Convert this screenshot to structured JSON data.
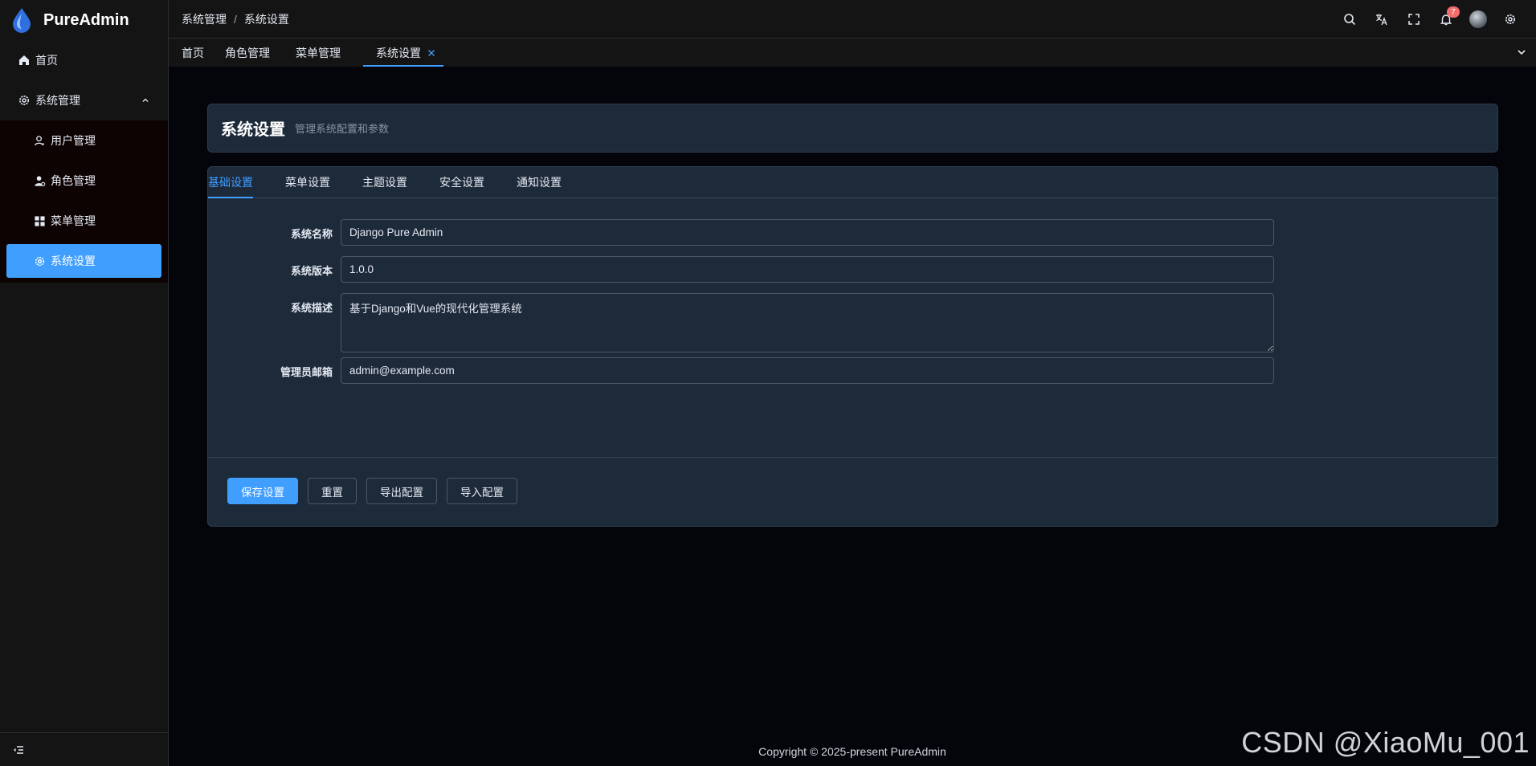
{
  "app": {
    "name": "PureAdmin"
  },
  "sidebar": {
    "home": "首页",
    "group": "系统管理",
    "items": [
      {
        "label": "用户管理",
        "icon": "user-icon"
      },
      {
        "label": "角色管理",
        "icon": "role-icon"
      },
      {
        "label": "菜单管理",
        "icon": "grid-icon"
      },
      {
        "label": "系统设置",
        "icon": "gear-icon",
        "active": true
      }
    ]
  },
  "breadcrumb": {
    "parent": "系统管理",
    "current": "系统设置",
    "separator": "/"
  },
  "header": {
    "notification_count": "7"
  },
  "tags": [
    "首页",
    "角色管理",
    "菜单管理",
    "系统设置"
  ],
  "page": {
    "title": "系统设置",
    "subtitle": "管理系统配置和参数"
  },
  "tabs": [
    "基础设置",
    "菜单设置",
    "主题设置",
    "安全设置",
    "通知设置"
  ],
  "form": {
    "system_name": {
      "label": "系统名称",
      "value": "Django Pure Admin"
    },
    "system_version": {
      "label": "系统版本",
      "value": "1.0.0"
    },
    "system_desc": {
      "label": "系统描述",
      "value": "基于Django和Vue的现代化管理系统"
    },
    "admin_email": {
      "label": "管理员邮箱",
      "value": "admin@example.com"
    }
  },
  "buttons": {
    "save": "保存设置",
    "reset": "重置",
    "export": "导出配置",
    "import": "导入配置"
  },
  "footer": {
    "copyright": "Copyright © 2025-present PureAdmin"
  },
  "watermark": "CSDN @XiaoMu_001",
  "colors": {
    "accent": "#409eff",
    "sidebar_bg": "#141414",
    "card_bg": "#1d2a3a",
    "badge": "#f56c6c"
  }
}
